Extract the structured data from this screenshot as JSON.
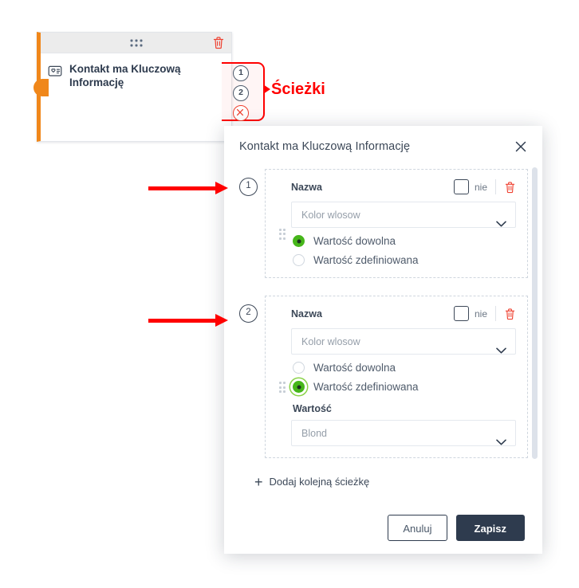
{
  "node": {
    "title": "Kontakt ma Kluczową Informację",
    "icon": "contact-card-heart-icon",
    "handle_icon": "drag-handle-dots-icon",
    "delete_icon": "trash-icon",
    "accent_color": "#f0871a",
    "badges": [
      {
        "label": "1",
        "name": "path-badge-1"
      },
      {
        "label": "2",
        "name": "path-badge-2"
      },
      {
        "label": "",
        "name": "path-badge-close"
      }
    ]
  },
  "annotation": {
    "bracket_label": "Ścieżki",
    "color": "#ff0000",
    "arrows": [
      {
        "name": "arrow-to-path-1"
      },
      {
        "name": "arrow-to-path-2"
      }
    ]
  },
  "modal": {
    "title": "Kontakt ma Kluczową Informację",
    "close_icon": "close-icon",
    "add_path_label": "Dodaj kolejną ścieżkę",
    "add_plus": "+",
    "cancel_label": "Anuluj",
    "save_label": "Zapisz",
    "paths": [
      {
        "number": "1",
        "name_label": "Nazwa",
        "negate_label": "nie",
        "negate_checked": false,
        "delete_icon": "trash-icon",
        "drag_icon": "drag-handle-dots-icon",
        "field_select_value": "Kolor wlosow",
        "field_select_placeholder": "Kolor wlosow",
        "radio_any_label": "Wartość dowolna",
        "radio_defined_label": "Wartość zdefiniowana",
        "selected_radio": "any",
        "value_label": "",
        "value_select": ""
      },
      {
        "number": "2",
        "name_label": "Nazwa",
        "negate_label": "nie",
        "negate_checked": false,
        "delete_icon": "trash-icon",
        "drag_icon": "drag-handle-dots-icon",
        "field_select_value": "Kolor wlosow",
        "field_select_placeholder": "Kolor wlosow",
        "radio_any_label": "Wartość dowolna",
        "radio_defined_label": "Wartość zdefiniowana",
        "selected_radio": "defined",
        "value_label": "Wartość",
        "value_select": "Blond"
      }
    ]
  }
}
